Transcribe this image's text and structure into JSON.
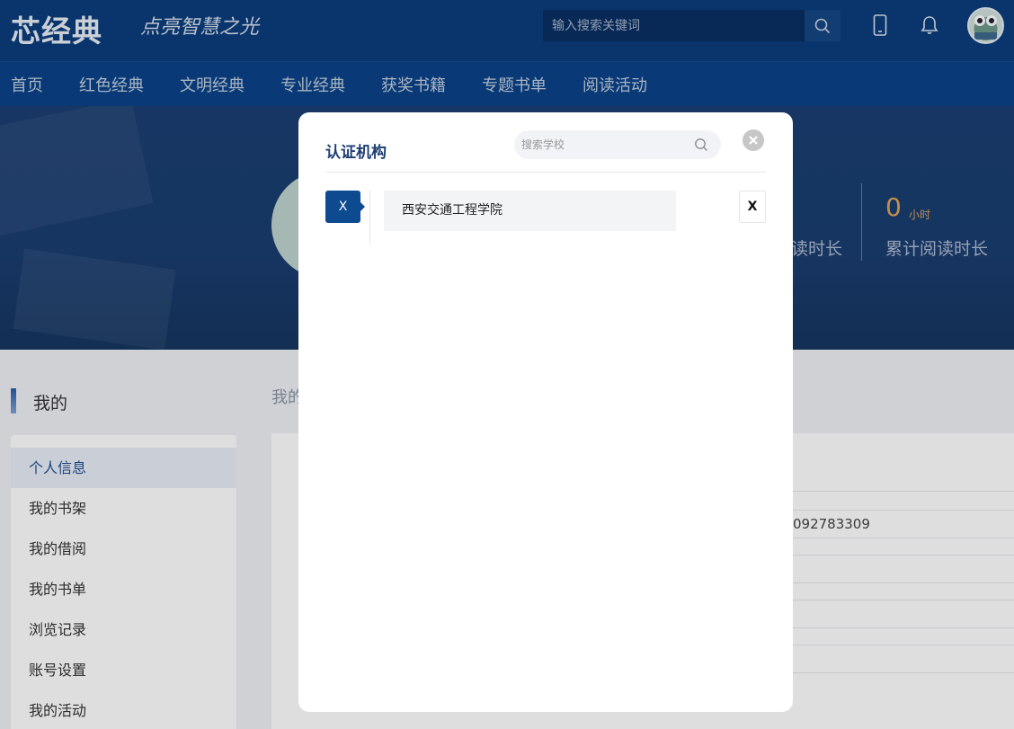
{
  "header": {
    "logo": "芯经典",
    "slogan": "点亮智慧之光",
    "search_placeholder": "输入搜索关键词",
    "icons": [
      "search-icon",
      "mobile-icon",
      "bell-icon",
      "avatar"
    ]
  },
  "nav": {
    "items": [
      "首页",
      "红色经典",
      "文明经典",
      "专业经典",
      "获奖书籍",
      "专题书单",
      "阅读活动"
    ]
  },
  "banner": {
    "stat_left_label": "读时长",
    "stat_value": "0",
    "stat_unit": "小时",
    "stat_label": "累计阅读时长"
  },
  "content": {
    "section_title": "我的",
    "breadcrumb": "我的",
    "phone_partial": "092783309",
    "sidebar": [
      "个人信息",
      "我的书架",
      "我的借阅",
      "我的书单",
      "浏览记录",
      "账号设置",
      "我的活动"
    ]
  },
  "modal": {
    "title": "认证机构",
    "search_placeholder": "搜索学校",
    "groups": [
      {
        "letter": "X",
        "schools": [
          "西安交通工程学院"
        ]
      }
    ],
    "index_letters": [
      "X"
    ]
  },
  "colors": {
    "header_bg": "#0b3c7d",
    "accent": "#0d4a8f",
    "stat_orange": "#e0a35c"
  }
}
